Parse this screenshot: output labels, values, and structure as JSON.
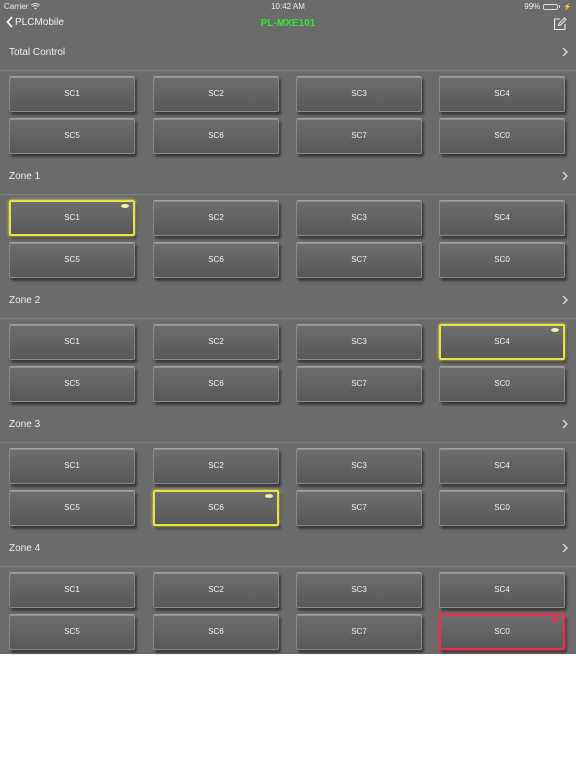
{
  "status_bar": {
    "carrier": "Carrier",
    "time": "10:42 AM",
    "battery": "99%"
  },
  "nav": {
    "back_label": "PLCMobile",
    "title": "PL-MXE101"
  },
  "colors": {
    "title": "#37e337",
    "active_yellow": "#e6e34a",
    "active_red": "#e2334a",
    "background": "#6b6b6b"
  },
  "sections": [
    {
      "title": "Total Control",
      "buttons": [
        {
          "label": "SC1",
          "state": "off"
        },
        {
          "label": "SC2",
          "state": "off"
        },
        {
          "label": "SC3",
          "state": "off"
        },
        {
          "label": "SC4",
          "state": "off"
        },
        {
          "label": "SC5",
          "state": "off"
        },
        {
          "label": "SC6",
          "state": "off"
        },
        {
          "label": "SC7",
          "state": "off"
        },
        {
          "label": "SC0",
          "state": "off"
        }
      ]
    },
    {
      "title": "Zone 1",
      "buttons": [
        {
          "label": "SC1",
          "state": "yellow"
        },
        {
          "label": "SC2",
          "state": "off"
        },
        {
          "label": "SC3",
          "state": "off"
        },
        {
          "label": "SC4",
          "state": "off"
        },
        {
          "label": "SC5",
          "state": "off"
        },
        {
          "label": "SC6",
          "state": "off"
        },
        {
          "label": "SC7",
          "state": "off"
        },
        {
          "label": "SC0",
          "state": "off"
        }
      ]
    },
    {
      "title": "Zone 2",
      "buttons": [
        {
          "label": "SC1",
          "state": "off"
        },
        {
          "label": "SC2",
          "state": "off"
        },
        {
          "label": "SC3",
          "state": "off"
        },
        {
          "label": "SC4",
          "state": "yellow"
        },
        {
          "label": "SC5",
          "state": "off"
        },
        {
          "label": "SC6",
          "state": "off"
        },
        {
          "label": "SC7",
          "state": "off"
        },
        {
          "label": "SC0",
          "state": "off"
        }
      ]
    },
    {
      "title": "Zone 3",
      "buttons": [
        {
          "label": "SC1",
          "state": "off"
        },
        {
          "label": "SC2",
          "state": "off"
        },
        {
          "label": "SC3",
          "state": "off"
        },
        {
          "label": "SC4",
          "state": "off"
        },
        {
          "label": "SC5",
          "state": "off"
        },
        {
          "label": "SC6",
          "state": "yellow"
        },
        {
          "label": "SC7",
          "state": "off"
        },
        {
          "label": "SC0",
          "state": "off"
        }
      ]
    },
    {
      "title": "Zone 4",
      "buttons": [
        {
          "label": "SC1",
          "state": "off"
        },
        {
          "label": "SC2",
          "state": "off"
        },
        {
          "label": "SC3",
          "state": "off"
        },
        {
          "label": "SC4",
          "state": "off"
        },
        {
          "label": "SC5",
          "state": "off"
        },
        {
          "label": "SC6",
          "state": "off"
        },
        {
          "label": "SC7",
          "state": "off"
        },
        {
          "label": "SC0",
          "state": "red"
        }
      ]
    }
  ]
}
